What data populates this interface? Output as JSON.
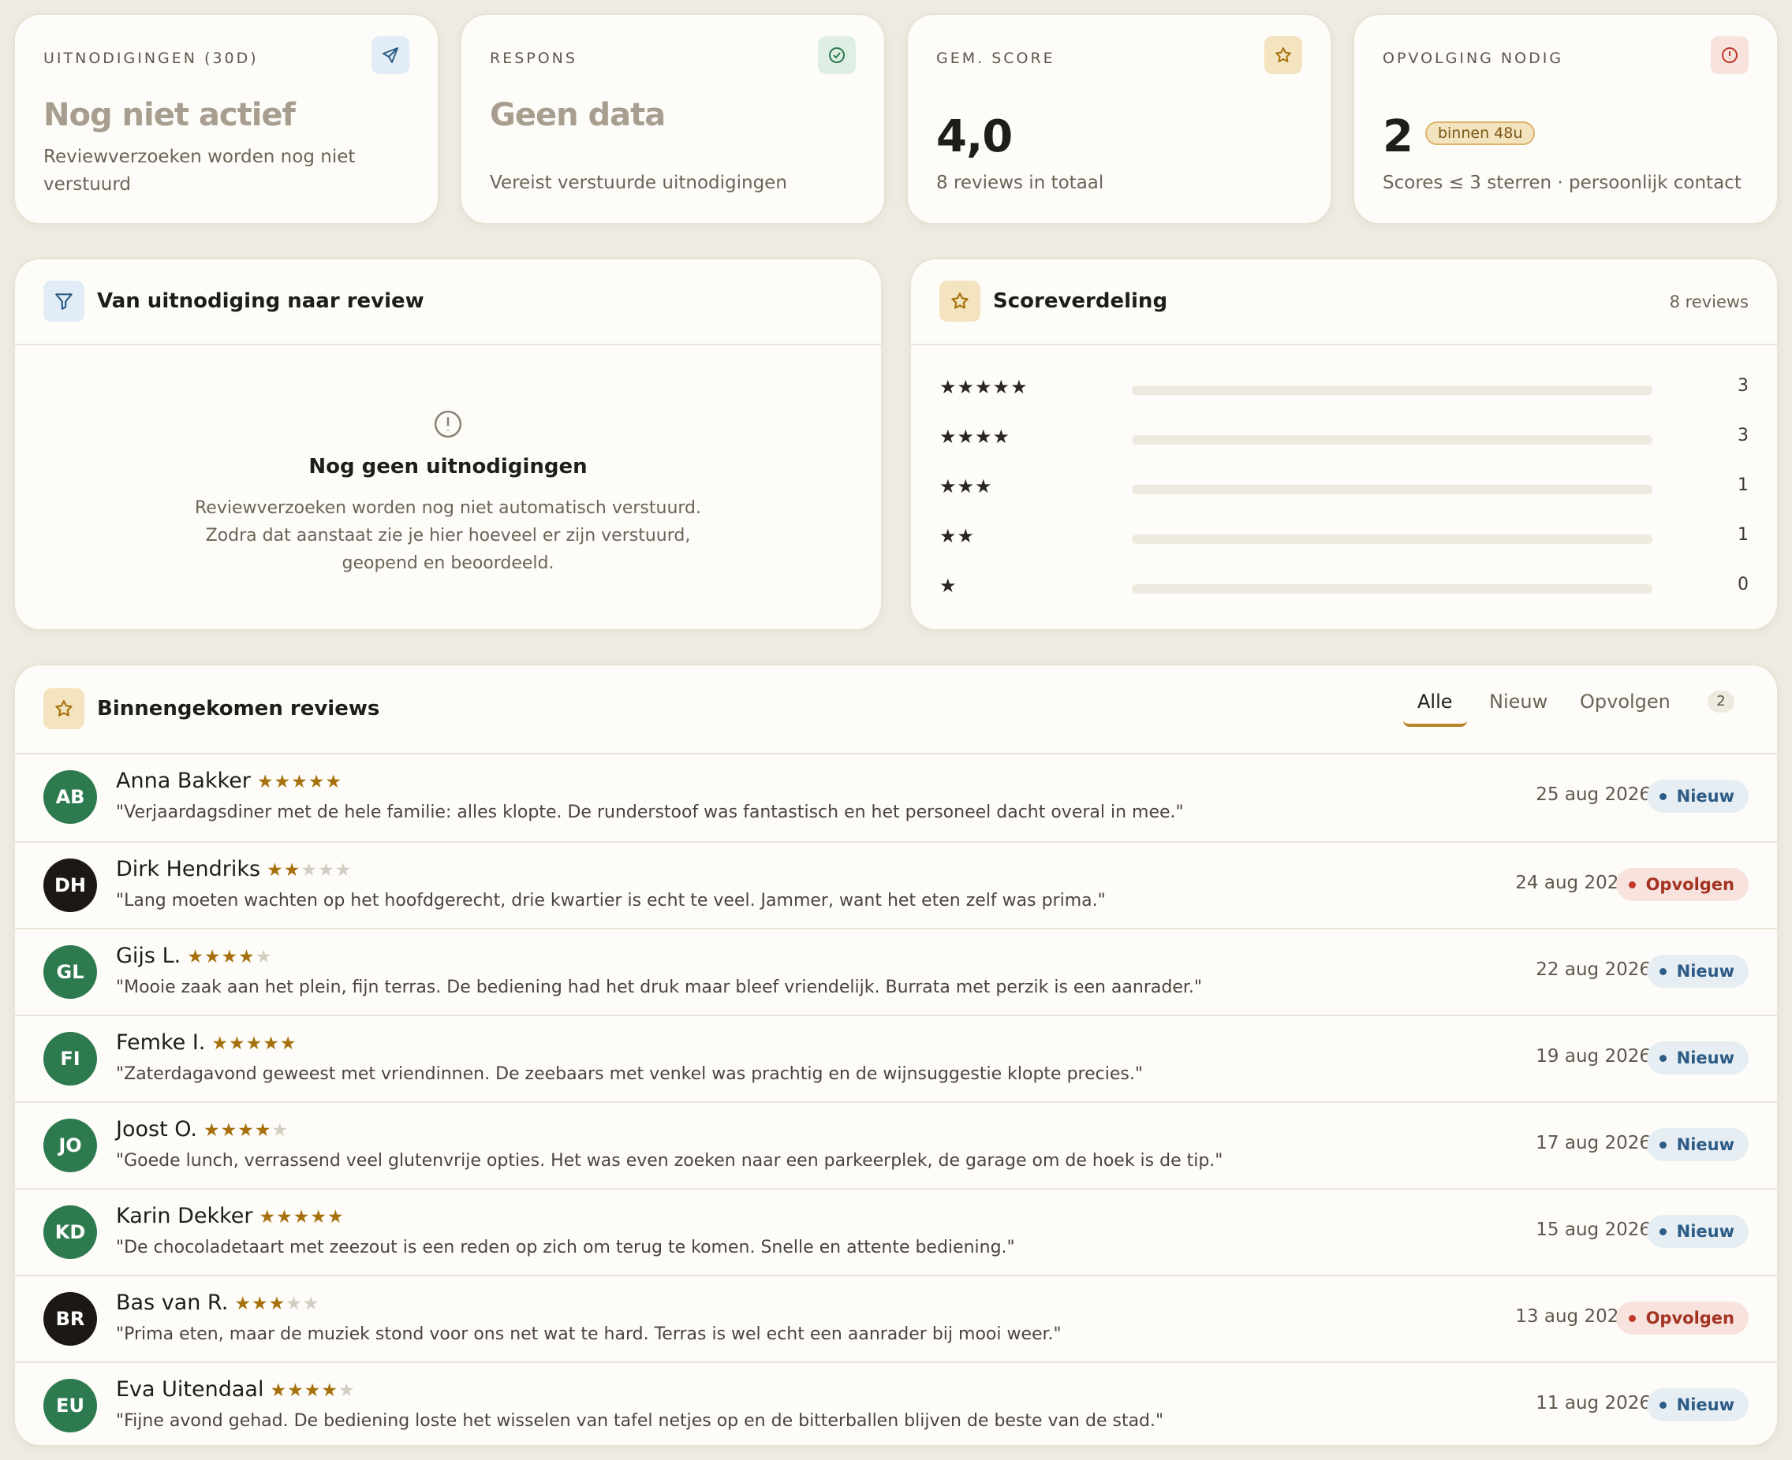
{
  "kpis": [
    {
      "label": "UITNODIGINGEN (30D)",
      "value": "Nog niet actief",
      "sub": "Reviewverzoeken worden nog niet verstuurd",
      "icon": "send-icon"
    },
    {
      "label": "RESPONS",
      "value": "Geen data",
      "sub": "Vereist verstuurde uitnodigingen",
      "icon": "check-circle-icon"
    },
    {
      "label": "GEM. SCORE",
      "value": "4,0",
      "sub": "8 reviews in totaal",
      "icon": "star-icon"
    },
    {
      "label": "OPVOLGING NODIG",
      "value": "2",
      "pill": "binnen 48u",
      "sub": "Scores ≤ 3 sterren · persoonlijk contact",
      "icon": "alert-circle-icon"
    }
  ],
  "funnel": {
    "title": "Van uitnodiging naar review",
    "empty_title": "Nog geen uitnodigingen",
    "empty_text": "Reviewverzoeken worden nog niet automatisch verstuurd. Zodra dat aanstaat zie je hier hoeveel er zijn verstuurd, geopend en beoordeeld."
  },
  "distribution": {
    "title": "Scoreverdeling",
    "total_label": "8 reviews",
    "rows": [
      {
        "stars": "★★★★★",
        "count": "3",
        "fraction": 0
      },
      {
        "stars": "★★★★",
        "count": "3",
        "fraction": 0
      },
      {
        "stars": "★★★",
        "count": "1",
        "fraction": 0
      },
      {
        "stars": "★★",
        "count": "1",
        "fraction": 0
      },
      {
        "stars": "★",
        "count": "0",
        "fraction": 0
      }
    ]
  },
  "reviews": {
    "title": "Binnengekomen reviews",
    "tabs": {
      "all": "Alle",
      "new": "Nieuw",
      "follow": "Opvolgen",
      "follow_count": "2"
    },
    "items": [
      {
        "initials": "AB",
        "name": "Anna Bakker",
        "rating": 5,
        "text": "\"Verjaardagsdiner met de hele familie: alles klopte. De runderstoof was fantastisch en het personeel dacht overal in mee.\"",
        "date": "25 aug 2026",
        "status": "Nieuw",
        "type": "new",
        "avatar_color": "#2e7a4f"
      },
      {
        "initials": "DH",
        "name": "Dirk Hendriks",
        "rating": 2,
        "text": "\"Lang moeten wachten op het hoofdgerecht, drie kwartier is echt te veel. Jammer, want het eten zelf was prima.\"",
        "date": "24 aug 2026",
        "status": "Opvolgen",
        "type": "follow",
        "avatar_color": "#1c1915"
      },
      {
        "initials": "GL",
        "name": "Gijs L.",
        "rating": 4,
        "text": "\"Mooie zaak aan het plein, fijn terras. De bediening had het druk maar bleef vriendelijk. Burrata met perzik is een aanrader.\"",
        "date": "22 aug 2026",
        "status": "Nieuw",
        "type": "new",
        "avatar_color": "#2e7a4f"
      },
      {
        "initials": "FI",
        "name": "Femke I.",
        "rating": 5,
        "text": "\"Zaterdagavond geweest met vriendinnen. De zeebaars met venkel was prachtig en de wijnsuggestie klopte precies.\"",
        "date": "19 aug 2026",
        "status": "Nieuw",
        "type": "new",
        "avatar_color": "#2e7a4f"
      },
      {
        "initials": "JO",
        "name": "Joost O.",
        "rating": 4,
        "text": "\"Goede lunch, verrassend veel glutenvrije opties. Het was even zoeken naar een parkeerplek, de garage om de hoek is de tip.\"",
        "date": "17 aug 2026",
        "status": "Nieuw",
        "type": "new",
        "avatar_color": "#2e7a4f"
      },
      {
        "initials": "KD",
        "name": "Karin Dekker",
        "rating": 5,
        "text": "\"De chocoladetaart met zeezout is een reden op zich om terug te komen. Snelle en attente bediening.\"",
        "date": "15 aug 2026",
        "status": "Nieuw",
        "type": "new",
        "avatar_color": "#2e7a4f"
      },
      {
        "initials": "BR",
        "name": "Bas van R.",
        "rating": 3,
        "text": "\"Prima eten, maar de muziek stond voor ons net wat te hard. Terras is wel echt een aanrader bij mooi weer.\"",
        "date": "13 aug 2026",
        "status": "Opvolgen",
        "type": "follow",
        "avatar_color": "#1c1915"
      },
      {
        "initials": "EU",
        "name": "Eva Uitendaal",
        "rating": 4,
        "text": "\"Fijne avond gehad. De bediening loste het wisselen van tafel netjes op en de bitterballen blijven de beste van de stad.\"",
        "date": "11 aug 2026",
        "status": "Nieuw",
        "type": "new",
        "avatar_color": "#2e7a4f"
      }
    ]
  },
  "colors": {
    "background": "#efebe2",
    "card": "#fdfcf8",
    "accent": "#b88428",
    "star": "#a6710d",
    "green": "#2e7a4f",
    "new_badge": "#2c5c86",
    "follow_badge": "#a23322"
  }
}
